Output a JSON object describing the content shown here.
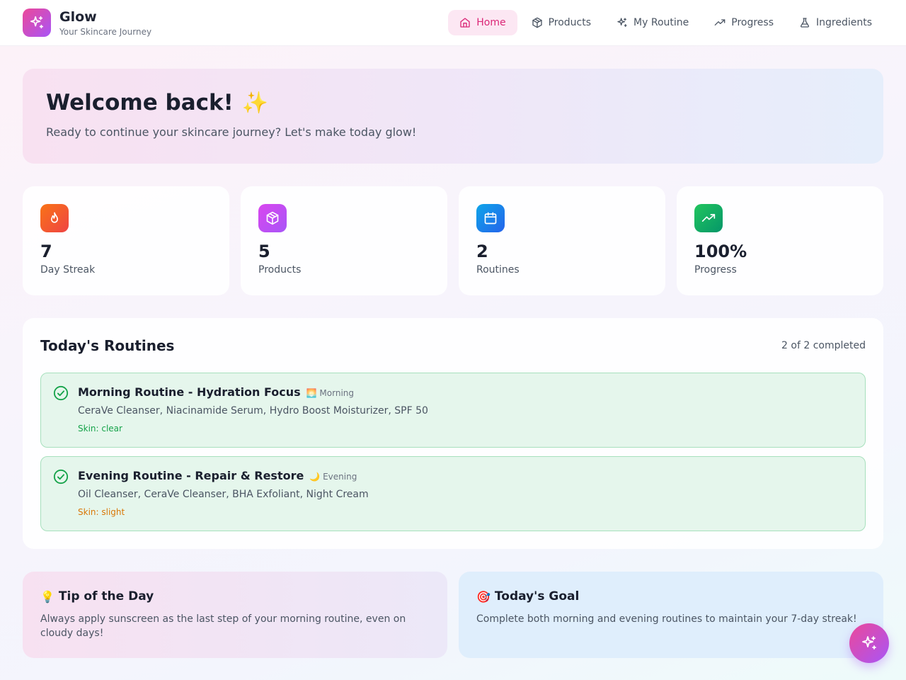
{
  "brand": {
    "name": "Glow",
    "tagline": "Your Skincare Journey",
    "icon": "sparkles-icon"
  },
  "nav": [
    {
      "label": "Home",
      "icon": "home-icon",
      "active": true
    },
    {
      "label": "Products",
      "icon": "package-icon",
      "active": false
    },
    {
      "label": "My Routine",
      "icon": "sparkles-icon",
      "active": false
    },
    {
      "label": "Progress",
      "icon": "trending-up-icon",
      "active": false
    },
    {
      "label": "Ingredients",
      "icon": "flask-icon",
      "active": false
    }
  ],
  "welcome": {
    "title": "Welcome back!",
    "emoji": "✨",
    "subtitle": "Ready to continue your skincare journey? Let's make today glow!"
  },
  "stats": [
    {
      "value": "7",
      "label": "Day Streak",
      "icon": "flame-icon",
      "color": "#ef4444"
    },
    {
      "value": "5",
      "label": "Products",
      "icon": "package-icon",
      "color": "#c026d3"
    },
    {
      "value": "2",
      "label": "Routines",
      "icon": "calendar-icon",
      "color": "#2563eb"
    },
    {
      "value": "100%",
      "label": "Progress",
      "icon": "trending-up-icon",
      "color": "#16a34a"
    }
  ],
  "routines": {
    "title": "Today's Routines",
    "count": "2 of 2 completed",
    "items": [
      {
        "title": "Morning Routine - Hydration Focus",
        "time": "🌅 Morning",
        "products": "CeraVe Cleanser, Niacinamide Serum, Hydro Boost Moisturizer, SPF 50",
        "skin": "Skin: clear",
        "skin_color": "#16a34a",
        "completed": true
      },
      {
        "title": "Evening Routine - Repair & Restore",
        "time": "🌙 Evening",
        "products": "Oil Cleanser, CeraVe Cleanser, BHA Exfoliant, Night Cream",
        "skin": "Skin: slight",
        "skin_color": "#d97706",
        "completed": true
      }
    ]
  },
  "tip": {
    "emoji": "💡",
    "title": "Tip of the Day",
    "text": "Always apply sunscreen as the last step of your morning routine, even on cloudy days!"
  },
  "goal": {
    "emoji": "🎯",
    "title": "Today's Goal",
    "text": "Complete both morning and evening routines to maintain your 7-day streak!"
  },
  "colors": {
    "accent": "#db2777",
    "brand_gradient_start": "#ec4899",
    "brand_gradient_end": "#a855f7",
    "success": "#16a34a"
  }
}
